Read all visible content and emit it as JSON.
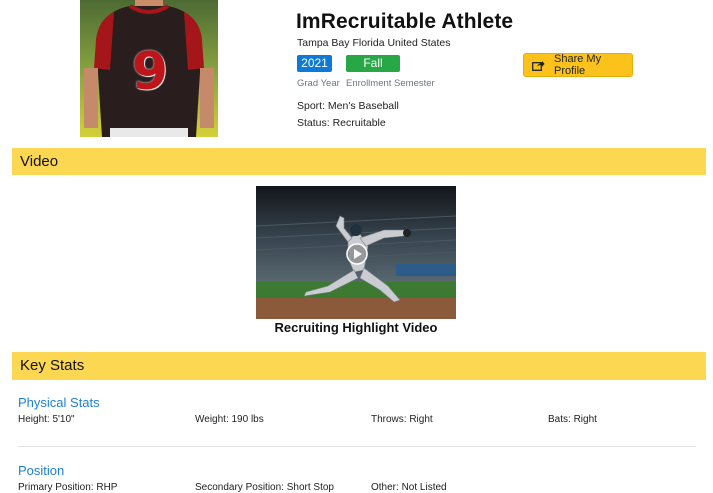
{
  "profile": {
    "name": "ImRecruitable Athlete",
    "location": "Tampa Bay Florida United States",
    "jersey_number": "9",
    "grad_year_value": "2021",
    "grad_year_label": "Grad Year",
    "enrollment_value": "Fall 2021",
    "enrollment_label": "Enrollment Semester",
    "sport": "Sport: Men's Baseball",
    "status": "Status: Recruitable",
    "share_label": "Share My Profile"
  },
  "colors": {
    "section_bar": "#fcd752",
    "share_button": "#fbc21c",
    "grad_year_badge": "#0d7ad9",
    "enrollment_badge": "#27a745",
    "heading_link": "#1e7fd6"
  },
  "video": {
    "section_title": "Video",
    "caption": "Recruiting Highlight Video",
    "icon": "play-icon"
  },
  "stats": {
    "section_title": "Key Stats",
    "physical": {
      "heading": "Physical Stats",
      "height": "Height: 5'10\"",
      "weight": "Weight: 190 lbs",
      "throws": "Throws: Right",
      "bats": "Bats: Right"
    },
    "position": {
      "heading": "Position",
      "primary": "Primary Position: RHP",
      "secondary": "Secondary Position: Short Stop",
      "other": "Other: Not Listed"
    }
  }
}
